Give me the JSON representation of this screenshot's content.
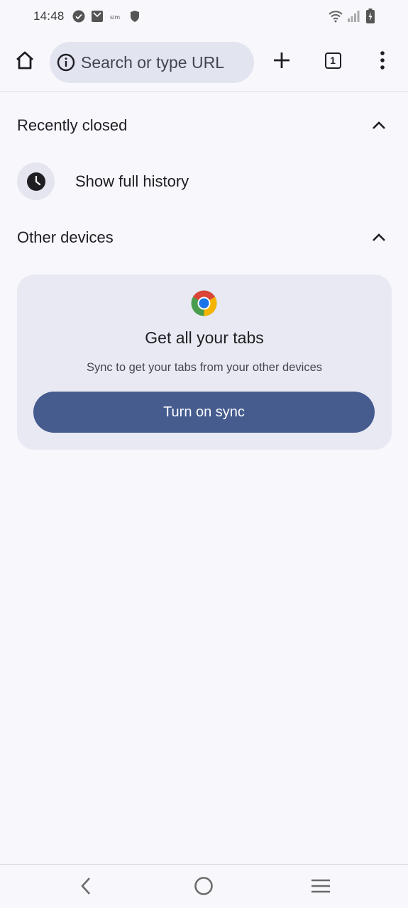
{
  "status_bar": {
    "time": "14:48",
    "icons": [
      "check-circle-icon",
      "mail-bag-icon",
      "sim-icon",
      "shield-icon",
      "wifi-icon",
      "cell-signal-icon",
      "battery-charging-icon"
    ]
  },
  "toolbar": {
    "home_icon": "home-icon",
    "omnibox_icon": "info-icon",
    "omnibox_placeholder": "Search or type URL",
    "new_tab_icon": "plus-icon",
    "tab_count": "1",
    "menu_icon": "more-vert-icon"
  },
  "recently_closed": {
    "title": "Recently closed",
    "chevron": "chevron-up-icon",
    "history_icon": "clock-icon",
    "history_label": "Show full history"
  },
  "other_devices": {
    "title": "Other devices",
    "chevron": "chevron-up-icon"
  },
  "sync_card": {
    "logo": "chrome-logo",
    "title": "Get all your tabs",
    "subtitle": "Sync to get your tabs from your other devices",
    "button_label": "Turn on sync"
  },
  "nav_bar": {
    "back_icon": "back-chevron-icon",
    "home_icon": "home-circle-icon",
    "recents_icon": "recents-lines-icon"
  },
  "colors": {
    "background": "#f7f7fc",
    "omnibox": "#e2e4f0",
    "card": "#e8e9f2",
    "button": "#465c8f",
    "text": "#1f1f23"
  }
}
